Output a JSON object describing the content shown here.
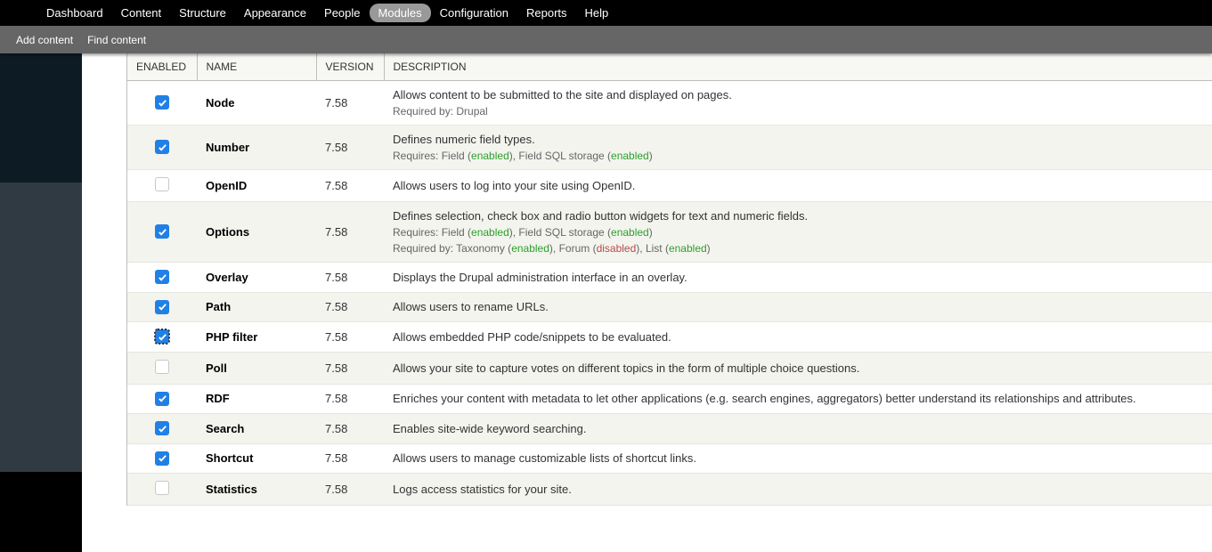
{
  "toolbar": {
    "items": [
      {
        "label": "Dashboard",
        "active": false
      },
      {
        "label": "Content",
        "active": false
      },
      {
        "label": "Structure",
        "active": false
      },
      {
        "label": "Appearance",
        "active": false
      },
      {
        "label": "People",
        "active": false
      },
      {
        "label": "Modules",
        "active": true
      },
      {
        "label": "Configuration",
        "active": false
      },
      {
        "label": "Reports",
        "active": false
      },
      {
        "label": "Help",
        "active": false
      }
    ]
  },
  "subtoolbar": {
    "items": [
      {
        "label": "Add content"
      },
      {
        "label": "Find content"
      }
    ]
  },
  "table": {
    "headers": {
      "enabled": "ENABLED",
      "name": "NAME",
      "version": "VERSION",
      "description": "DESCRIPTION"
    },
    "rows": [
      {
        "checked": true,
        "focus": false,
        "name": "Node",
        "version": "7.58",
        "desc": "Allows content to be submitted to the site and displayed on pages.",
        "sub_parts": [
          [
            {
              "t": "Required by: Drupal"
            }
          ]
        ]
      },
      {
        "checked": true,
        "focus": false,
        "name": "Number",
        "version": "7.58",
        "desc": "Defines numeric field types.",
        "sub_parts": [
          [
            {
              "t": "Requires: Field ("
            },
            {
              "t": "enabled",
              "cls": "enabled"
            },
            {
              "t": "), Field SQL storage ("
            },
            {
              "t": "enabled",
              "cls": "enabled"
            },
            {
              "t": ")"
            }
          ]
        ]
      },
      {
        "checked": false,
        "focus": false,
        "name": "OpenID",
        "version": "7.58",
        "desc": "Allows users to log into your site using OpenID.",
        "sub_parts": []
      },
      {
        "checked": true,
        "focus": false,
        "name": "Options",
        "version": "7.58",
        "desc": "Defines selection, check box and radio button widgets for text and numeric fields.",
        "sub_parts": [
          [
            {
              "t": "Requires: Field ("
            },
            {
              "t": "enabled",
              "cls": "enabled"
            },
            {
              "t": "), Field SQL storage ("
            },
            {
              "t": "enabled",
              "cls": "enabled"
            },
            {
              "t": ")"
            }
          ],
          [
            {
              "t": "Required by: Taxonomy ("
            },
            {
              "t": "enabled",
              "cls": "enabled"
            },
            {
              "t": "), Forum ("
            },
            {
              "t": "disabled",
              "cls": "disabled"
            },
            {
              "t": "), List ("
            },
            {
              "t": "enabled",
              "cls": "enabled"
            },
            {
              "t": ")"
            }
          ]
        ]
      },
      {
        "checked": true,
        "focus": false,
        "name": "Overlay",
        "version": "7.58",
        "desc": "Displays the Drupal administration interface in an overlay.",
        "sub_parts": []
      },
      {
        "checked": true,
        "focus": false,
        "name": "Path",
        "version": "7.58",
        "desc": "Allows users to rename URLs.",
        "sub_parts": []
      },
      {
        "checked": true,
        "focus": true,
        "name": "PHP filter",
        "version": "7.58",
        "desc": "Allows embedded PHP code/snippets to be evaluated.",
        "sub_parts": []
      },
      {
        "checked": false,
        "focus": false,
        "name": "Poll",
        "version": "7.58",
        "desc": "Allows your site to capture votes on different topics in the form of multiple choice questions.",
        "sub_parts": []
      },
      {
        "checked": true,
        "focus": false,
        "name": "RDF",
        "version": "7.58",
        "desc": "Enriches your content with metadata to let other applications (e.g. search engines, aggregators) better understand its relationships and attributes.",
        "sub_parts": []
      },
      {
        "checked": true,
        "focus": false,
        "name": "Search",
        "version": "7.58",
        "desc": "Enables site-wide keyword searching.",
        "sub_parts": []
      },
      {
        "checked": true,
        "focus": false,
        "name": "Shortcut",
        "version": "7.58",
        "desc": "Allows users to manage customizable lists of shortcut links.",
        "sub_parts": []
      },
      {
        "checked": false,
        "focus": false,
        "name": "Statistics",
        "version": "7.58",
        "desc": "Logs access statistics for your site.",
        "sub_parts": []
      }
    ]
  }
}
